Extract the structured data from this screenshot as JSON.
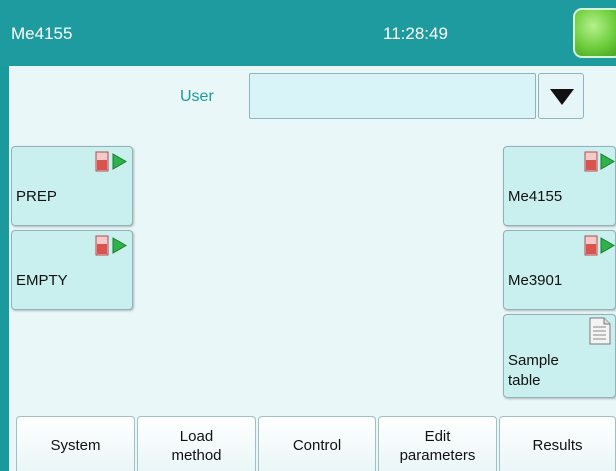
{
  "header": {
    "title": "Me4155",
    "time": "11:28:49",
    "status_color": "#6ccc3a"
  },
  "user": {
    "label": "User",
    "value": ""
  },
  "left_methods": [
    {
      "label": "PREP"
    },
    {
      "label": "EMPTY"
    }
  ],
  "right_methods": [
    {
      "label": "Me4155"
    },
    {
      "label": "Me3901"
    }
  ],
  "sample_table": {
    "label": "Sample\ntable"
  },
  "tabs": {
    "system": "System",
    "load_method": "Load\nmethod",
    "control": "Control",
    "edit_parameters": "Edit\nparameters",
    "results": "Results"
  },
  "colors": {
    "accent": "#1d9b9e",
    "tile": "#c9f0ef",
    "background": "#e9f7f9"
  }
}
